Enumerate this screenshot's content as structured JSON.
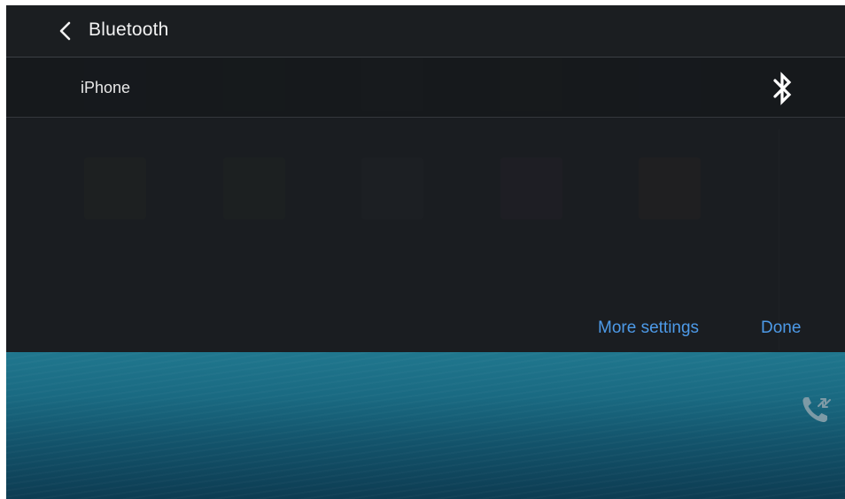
{
  "header": {
    "title": "Bluetooth"
  },
  "devices": [
    {
      "name": "iPhone",
      "icon": "bluetooth-icon"
    }
  ],
  "actions": {
    "more_settings": "More settings",
    "done": "Done"
  },
  "icons": {
    "back": "chevron-left-icon",
    "bluetooth": "bluetooth-icon",
    "call": "phone-transfer-icon"
  },
  "colors": {
    "accent": "#4d9ae8",
    "panel_bg": "#1b1e21",
    "text_primary": "#f2f2f2",
    "call_icon": "#7d9aa6"
  }
}
